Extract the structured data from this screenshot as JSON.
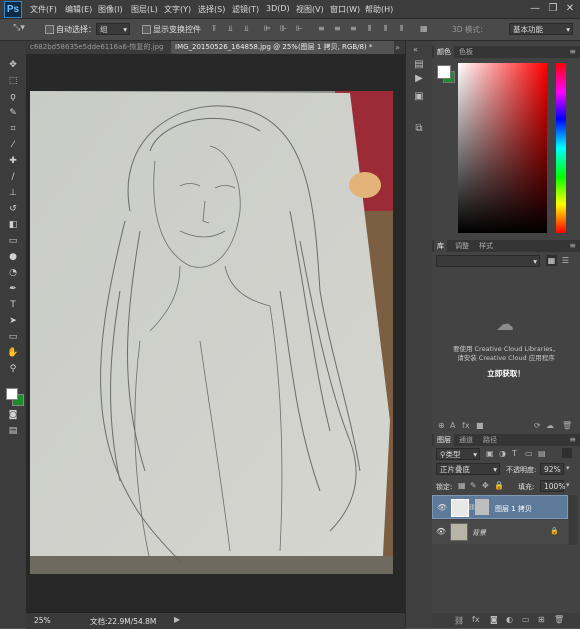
{
  "app": {
    "logo": "Ps"
  },
  "menu": [
    "文件(F)",
    "编辑(E)",
    "图像(I)",
    "图层(L)",
    "文字(Y)",
    "选择(S)",
    "滤镜(T)",
    "3D(D)",
    "视图(V)",
    "窗口(W)",
    "帮助(H)"
  ],
  "window_controls": {
    "minimize": "—",
    "restore": "❐",
    "close": "✕"
  },
  "options_bar": {
    "auto_select_label": "自动选择：",
    "auto_select_value": "组",
    "show_transform_label": "显示变换控件",
    "mode_3d_label": "3D 模式：",
    "workspace_value": "基本功能"
  },
  "tabs": [
    {
      "label": "c682bd58635e5dde6116a6-恢复的.jpg",
      "active": false
    },
    {
      "label": "IMG_20150526_164858.jpg @ 25%(图层 1 拷贝, RGB/8) *",
      "active": true
    }
  ],
  "status": {
    "zoom": "25%",
    "doc_info": "文档:22.9M/54.8M"
  },
  "color_panel": {
    "tabs": [
      "颜色",
      "色板"
    ],
    "foreground": "#ffffff",
    "background": "#1d8b2a"
  },
  "library_panel": {
    "tabs": [
      "库",
      "调整",
      "样式"
    ],
    "message_line1": "要使用 Creative Cloud Libraries，",
    "message_line2": "请安装 Creative Cloud 应用程序",
    "link": "立即获取！"
  },
  "layers_panel": {
    "tabs": [
      "图层",
      "通道",
      "路径"
    ],
    "filter_kind": "类型",
    "blend_mode": "正片叠底",
    "opacity_label": "不透明度:",
    "opacity_value": "92%",
    "lock_label": "锁定:",
    "fill_label": "填充:",
    "fill_value": "100%",
    "layers": [
      {
        "name": "图层 1 拷贝",
        "selected": true
      },
      {
        "name": "背景",
        "selected": false
      }
    ]
  },
  "colors": {
    "accent": "#31a8ff",
    "selected_layer": "#5e7a9a",
    "canvas_bg": "#282828",
    "panel_bg": "#434343"
  }
}
